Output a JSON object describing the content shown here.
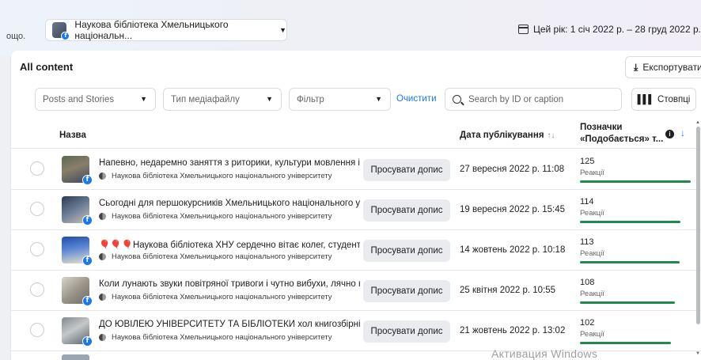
{
  "topbar": {
    "crumb_text": "ощо.",
    "page_selector": "Наукова бібліотека Хмельницького національн...",
    "date_range": "Цей рік: 1 січ 2022 р. – 28 груд 2022 р."
  },
  "content": {
    "title": "All content",
    "export_label": "Експортувати"
  },
  "filters": {
    "content_type": "Posts and Stories",
    "media_type": "Тип медіафайлу",
    "filter": "Фільтр",
    "clear": "Очистити",
    "search_placeholder": "Search by ID or caption",
    "columns": "Стовпці"
  },
  "table": {
    "headers": {
      "name": "Назва",
      "date": "Дата публікування",
      "likes_line1": "Позначки",
      "likes_line2": "«Подобається» т..."
    },
    "rows": [
      {
        "title": "Напевно, недаремно заняття з риторики, культури мовлення і с...",
        "page": "Наукова бібліотека Хмельницького національного університету",
        "boost": "Просувати допис",
        "date": "27 вересня 2022 р. 11:08",
        "likes": "125",
        "likes_fraction": 1.0,
        "reactions_label": "Реакції"
      },
      {
        "title": "Сьогодні для першокурсників Хмельницького національного ун...",
        "page": "Наукова бібліотека Хмельницького національного університету",
        "boost": "Просувати допис",
        "date": "19 вересня 2022 р. 15:45",
        "likes": "114",
        "likes_fraction": 0.91,
        "reactions_label": "Реакції"
      },
      {
        "title": "🎈🎈🎈Наукова бібліотека ХНУ сердечно вітає колег, студентів, ...",
        "page": "Наукова бібліотека Хмельницького національного університету",
        "boost": "Просувати допис",
        "date": "14 жовтень 2022 р. 10:18",
        "likes": "113",
        "likes_fraction": 0.9,
        "reactions_label": "Реакції"
      },
      {
        "title": "Коли лунають звуки повітряної тривоги і чутно вибухи, лячно н...",
        "page": "Наукова бібліотека Хмельницького національного університету",
        "boost": "Просувати допис",
        "date": "25 квітня 2022 р. 10:55",
        "likes": "108",
        "likes_fraction": 0.86,
        "reactions_label": "Реакції"
      },
      {
        "title": "ДО ЮВІЛЕЮ УНІВЕРСИТЕТУ ТА БІБЛІОТЕКИ хол книгозбірні при...",
        "page": "Наукова бібліотека Хмельницького національного університету",
        "boost": "Просувати допис",
        "date": "21 жовтень 2022 р. 13:02",
        "likes": "102",
        "likes_fraction": 0.82,
        "reactions_label": "Реакції"
      }
    ]
  },
  "watermark": "Активация Windows",
  "colors": {
    "accent": "#1877f2",
    "bar": "#1e8a4c"
  }
}
